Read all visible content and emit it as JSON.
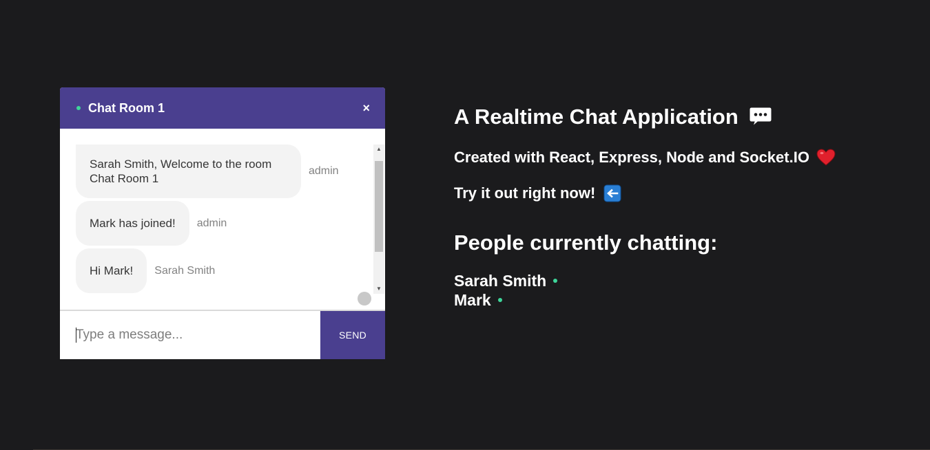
{
  "chat": {
    "room_name": "Chat Room 1",
    "close_label": "×",
    "messages": [
      {
        "text": "Sarah Smith, Welcome to the room Chat Room 1",
        "sender": "admin"
      },
      {
        "text": "Mark has joined!",
        "sender": "admin"
      },
      {
        "text": "Hi Mark!",
        "sender": "Sarah Smith"
      }
    ],
    "input_placeholder": "Type a message...",
    "input_value": "",
    "send_label": "SEND"
  },
  "info": {
    "title": "A Realtime Chat Application",
    "title_icon": "speech-balloon-icon",
    "subtitle": "Created with React, Express, Node and Socket.IO",
    "subtitle_icon": "heart-icon",
    "cta": "Try it out right now!",
    "cta_icon": "left-arrow-icon",
    "people_heading": "People currently chatting:",
    "people": [
      {
        "name": "Sarah Smith"
      },
      {
        "name": "Mark"
      }
    ]
  },
  "colors": {
    "background": "#1b1b1d",
    "accent": "#4a3f8f",
    "online": "#3ed69a",
    "bubble": "#f3f3f3",
    "heart": "#e0202c",
    "arrow_key": "#2a7fd4"
  }
}
